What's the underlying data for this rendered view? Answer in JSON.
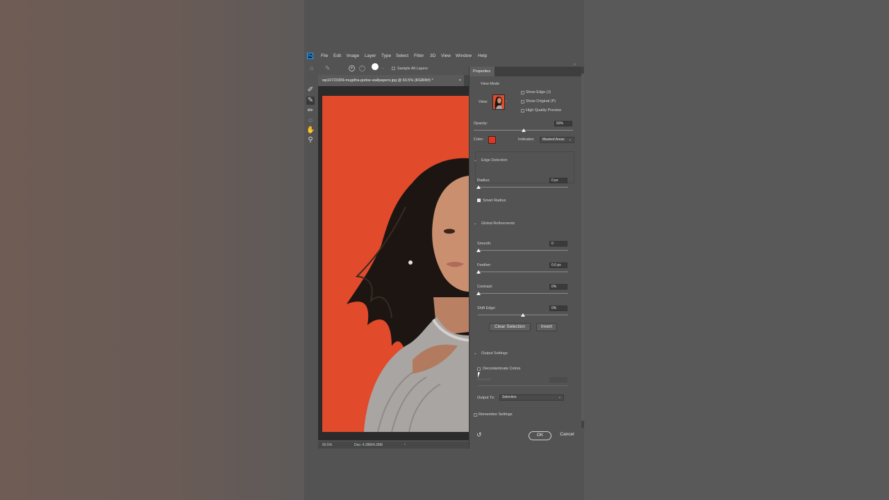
{
  "app": {
    "logo": "Ps",
    "menu": [
      "File",
      "Edit",
      "Image",
      "Layer",
      "Type",
      "Select",
      "Filter",
      "3D",
      "View",
      "Window",
      "Help"
    ]
  },
  "options_bar": {
    "sample_all_layers": "Sample All Layers"
  },
  "document": {
    "tab_title": "wp10723309-mugdha-godse-wallpapers.jpg @ 60.5% (RGB/8#) *",
    "tab_close": "×",
    "zoom": "60.5%",
    "doc_info": "Doc: 4.28M/4.28M",
    "status_arrow": "›"
  },
  "properties": {
    "tab": "Properties",
    "view_mode": {
      "section": "View Mode",
      "view_label": "View:",
      "show_edge": "Show Edge (J)",
      "show_original": "Show Original (P)",
      "high_quality_preview": "High Quality Preview"
    },
    "opacity": {
      "label": "Opacity:",
      "value": "50%",
      "level": 0.5
    },
    "color": {
      "label": "Color:",
      "swatch": "#e8341c"
    },
    "indicates": {
      "label": "Indicates:",
      "value": "Masked Areas"
    },
    "edge_detection": {
      "section": "Edge Detection",
      "radius_label": "Radius:",
      "radius_value": "0 px",
      "smart_radius": "Smart Radius",
      "smart_radius_checked": true
    },
    "global_refinements": {
      "section": "Global Refinements",
      "smooth_label": "Smooth:",
      "smooth_value": "0",
      "feather_label": "Feather:",
      "feather_value": "0.0 px",
      "contrast_label": "Contrast:",
      "contrast_value": "0%",
      "shift_edge_label": "Shift Edge:",
      "shift_edge_value": "0%"
    },
    "buttons": {
      "clear_selection": "Clear Selection",
      "invert": "Invert"
    },
    "output_settings": {
      "section": "Output Settings",
      "decontaminate": "Decontaminate Colors",
      "amount_label": "Amount:",
      "output_to_label": "Output To:",
      "output_to_value": "Selection"
    },
    "remember_settings": "Remember Settings",
    "ok": "OK",
    "cancel": "Cancel"
  },
  "colors": {
    "canvas_background": "#e14a2b",
    "ui_panel": "#535353",
    "ui_dark": "#3b3b3b"
  }
}
